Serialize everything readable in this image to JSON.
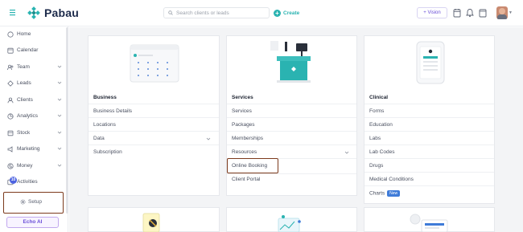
{
  "app": {
    "name": "Pabau"
  },
  "header": {
    "search_placeholder": "Search clients or leads",
    "create_label": "Create",
    "vision_label": "+ Vision"
  },
  "sidebar": {
    "items": [
      {
        "label": "Home",
        "icon": "home-icon",
        "has_chevron": false
      },
      {
        "label": "Calendar",
        "icon": "calendar-icon",
        "has_chevron": false
      },
      {
        "label": "Team",
        "icon": "team-icon",
        "has_chevron": true
      },
      {
        "label": "Leads",
        "icon": "leads-icon",
        "has_chevron": true
      },
      {
        "label": "Clients",
        "icon": "clients-icon",
        "has_chevron": true
      },
      {
        "label": "Analytics",
        "icon": "analytics-icon",
        "has_chevron": true
      },
      {
        "label": "Stock",
        "icon": "stock-icon",
        "has_chevron": true
      },
      {
        "label": "Marketing",
        "icon": "marketing-icon",
        "has_chevron": true
      },
      {
        "label": "Money",
        "icon": "money-icon",
        "has_chevron": true
      },
      {
        "label": "Activities",
        "icon": "activities-icon",
        "has_chevron": false
      }
    ],
    "activities_badge": "10",
    "setup_label": "Setup",
    "echo_label": "Echo AI"
  },
  "cards": {
    "business": {
      "title": "Business",
      "links": [
        "Business Details",
        "Locations",
        "Data",
        "Subscription"
      ]
    },
    "services": {
      "title": "Services",
      "links": [
        "Services",
        "Packages",
        "Memberships",
        "Resources",
        "Online Booking",
        "Client Portal"
      ]
    },
    "clinical": {
      "title": "Clinical",
      "links": [
        "Forms",
        "Education",
        "Labs",
        "Lab Codes",
        "Drugs",
        "Medical Conditions",
        "Charts"
      ],
      "new_badge": "New"
    }
  },
  "colors": {
    "brand": "#2ab3b1",
    "accent_purple": "#6b4fd8",
    "highlight_border": "#7c3a1c",
    "badge_blue": "#3e7bd8"
  }
}
